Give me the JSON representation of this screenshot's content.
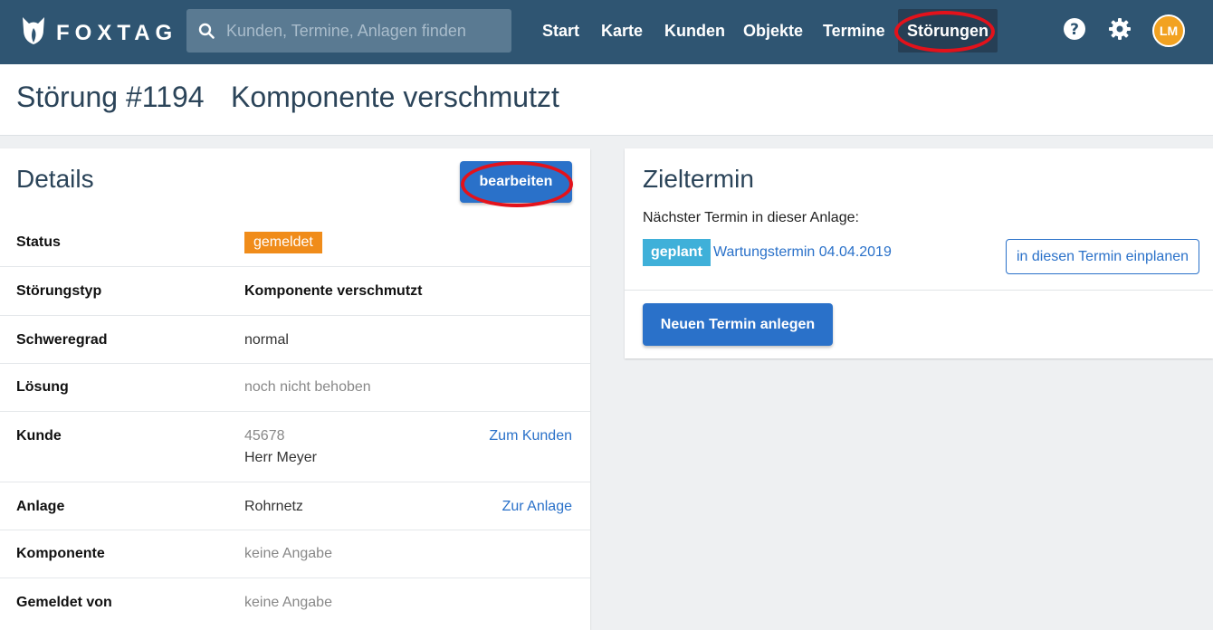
{
  "app": {
    "logo_text": "FOXTAG"
  },
  "search": {
    "placeholder": "Kunden, Termine, Anlagen finden"
  },
  "nav": {
    "start": "Start",
    "karte": "Karte",
    "kunden": "Kunden",
    "objekte": "Objekte",
    "termine": "Termine",
    "stoerungen": "Störungen"
  },
  "user": {
    "initials": "LM"
  },
  "page": {
    "number": "Störung #1194",
    "subtitle": "Komponente verschmutzt"
  },
  "details": {
    "title": "Details",
    "edit_label": "bearbeiten",
    "status_label": "Status",
    "status_value": "gemeldet",
    "type_label": "Störungstyp",
    "type_value": "Komponente verschmutzt",
    "severity_label": "Schweregrad",
    "severity_value": "normal",
    "solution_label": "Lösung",
    "solution_value": "noch nicht behoben",
    "customer_label": "Kunde",
    "customer_number": "45678",
    "customer_name": "Herr Meyer",
    "customer_link": "Zum Kunden",
    "plant_label": "Anlage",
    "plant_value": "Rohrnetz",
    "plant_link": "Zur Anlage",
    "component_label": "Komponente",
    "component_value": "keine Angabe",
    "reported_label": "Gemeldet von",
    "reported_value": "keine Angabe"
  },
  "target": {
    "title": "Zieltermin",
    "next_text": "Nächster Termin in dieser Anlage:",
    "badge": "geplant",
    "appointment_link": "Wartungstermin 04.04.2019",
    "schedule_button": "in diesen Termin einplanen",
    "new_button": "Neuen Termin anlegen"
  },
  "colors": {
    "topbar": "#2f5572",
    "accent": "#2a71c9",
    "status_orange": "#f08c1a",
    "planned_blue": "#3fb0d9",
    "highlight_red": "#e3121b"
  }
}
